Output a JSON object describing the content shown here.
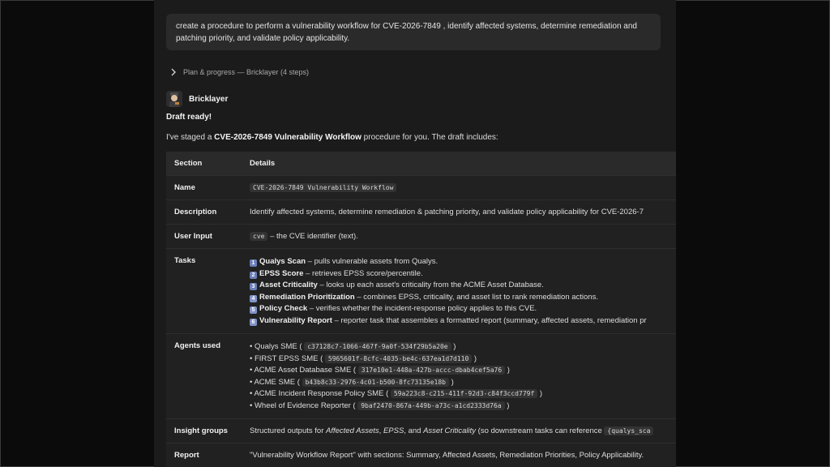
{
  "prompt": {
    "text": "create a procedure to perform a vulnerability workflow for CVE-2026-7849 , identify affected systems, determine remediation and patching priority, and validate policy applicability."
  },
  "plan": {
    "label": "Plan & progress — Bricklayer (4 steps)"
  },
  "agent": {
    "name": "Bricklayer"
  },
  "message": {
    "draft": "Draft ready!",
    "intro_pre": "I've staged a ",
    "intro_bold": "CVE-2026-7849 Vulnerability Workflow",
    "intro_post": " procedure for you. The draft includes:"
  },
  "table": {
    "headers": [
      "Section",
      "Details"
    ],
    "name": {
      "label": "Name",
      "value": "CVE-2026-7849 Vulnerability Workflow"
    },
    "description": {
      "label": "Description",
      "value": "Identify affected systems, determine remediation & patching priority, and validate policy applicability for CVE-2026-7"
    },
    "user_input": {
      "label": "User Input",
      "code": "cve",
      "text": " – the CVE identifier (text)."
    },
    "tasks": {
      "label": "Tasks",
      "items": [
        {
          "badge": "1",
          "name": "Qualys Scan",
          "desc": " – pulls vulnerable assets from Qualys."
        },
        {
          "badge": "2",
          "name": "EPSS Score",
          "desc": " – retrieves EPSS score/percentile."
        },
        {
          "badge": "3",
          "name": "Asset Criticality",
          "desc": " – looks up each asset's criticality from the ACME Asset Database."
        },
        {
          "badge": "4",
          "name": "Remediation Prioritization",
          "desc": " – combines EPSS, criticality, and asset list to rank remediation actions."
        },
        {
          "badge": "5",
          "name": "Policy Check",
          "desc": " – verifies whether the incident-response policy applies to this CVE."
        },
        {
          "badge": "6",
          "name": "Vulnerability Report",
          "desc": " – reporter task that assembles a formatted report (summary, affected assets, remediation pr"
        }
      ]
    },
    "agents": {
      "label": "Agents used",
      "items": [
        {
          "name": "• Qualys SME (",
          "id": "c37128c7-1066-467f-9a0f-534f29b5a20e",
          "close": ")"
        },
        {
          "name": "• FIRST EPSS SME (",
          "id": "5965601f-8cfc-4035-be4c-637ea1d7d110",
          "close": ")"
        },
        {
          "name": "• ACME Asset Database SME (",
          "id": "317e10e1-448a-427b-accc-dbab4cef5a76",
          "close": ")"
        },
        {
          "name": "• ACME SME (",
          "id": "b43b8c33-2976-4c01-b500-8fc73135e18b",
          "close": ")"
        },
        {
          "name": "• ACME Incident Response Policy SME (",
          "id": "59a223c8-c215-411f-92d3-c84f3ccd779f",
          "close": ")"
        },
        {
          "name": "• Wheel of Evidence Reporter (",
          "id": "9baf2470-867a-449b-a73c-a1cd2333d76a",
          "close": ")"
        }
      ]
    },
    "insight": {
      "label": "Insight groups",
      "pre": "Structured outputs for ",
      "i1": "Affected Assets",
      "sep1": ", ",
      "i2": "EPSS",
      "sep2": ", and ",
      "i3": "Asset Criticality",
      "post": " (so downstream tasks can reference ",
      "code": "{qualys_sca"
    },
    "report": {
      "label": "Report",
      "value": "\"Vulnerability Workflow Report\" with sections: Summary, Affected Assets, Remediation Priorities, Policy Applicability."
    }
  }
}
